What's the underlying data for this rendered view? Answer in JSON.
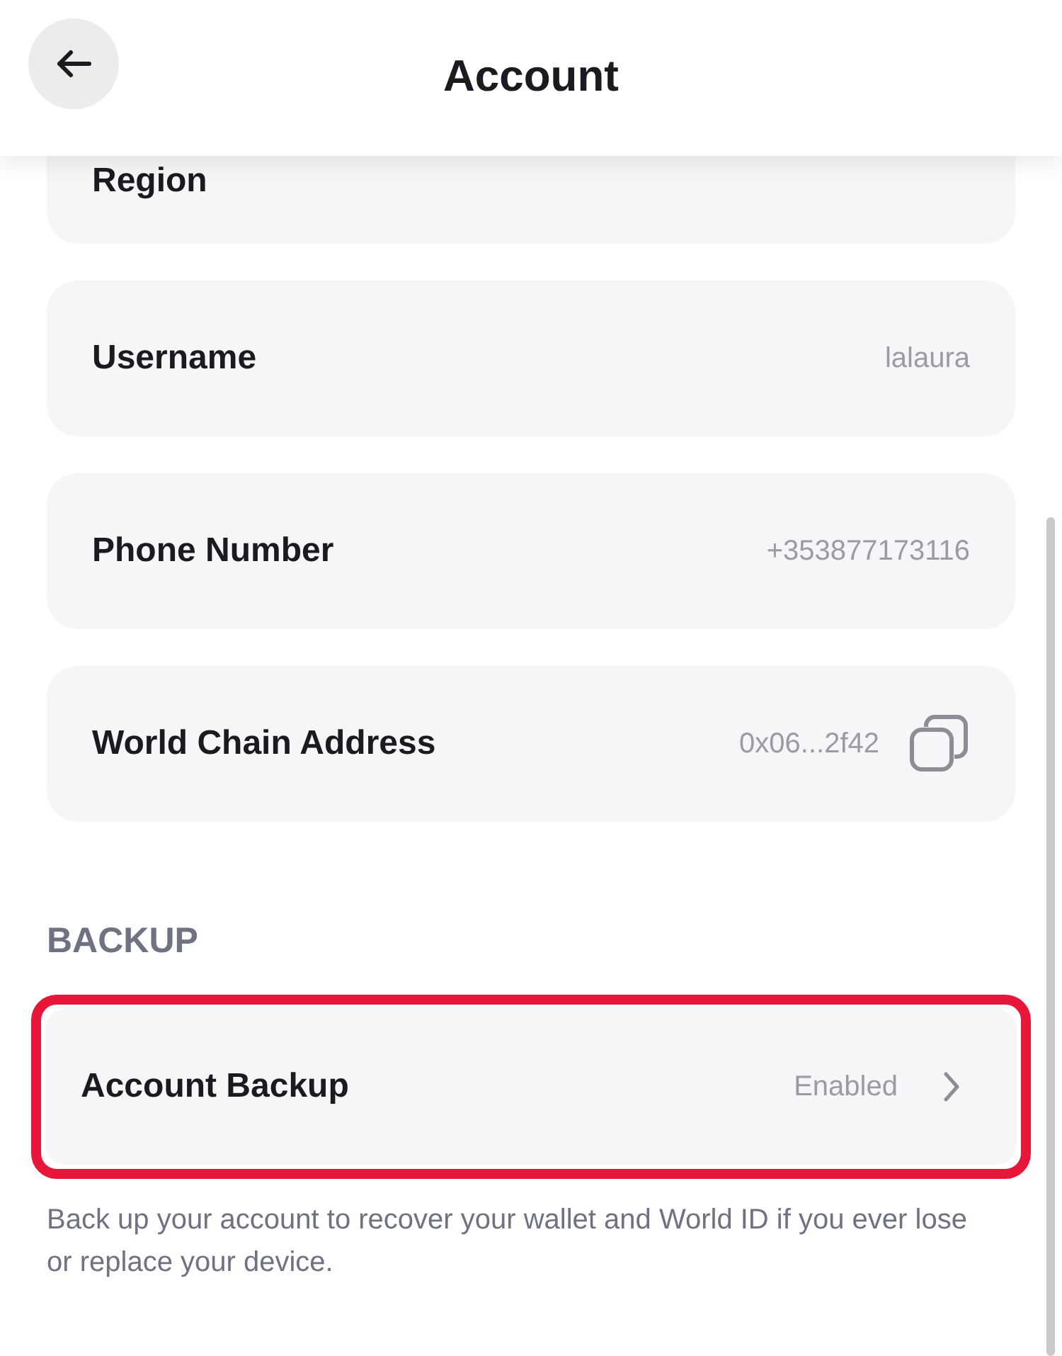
{
  "header": {
    "title": "Account"
  },
  "rows": [
    {
      "label": "Region",
      "copy": false
    },
    {
      "label": "Username",
      "value": "lalaura",
      "copy": false
    },
    {
      "label": "Phone Number",
      "value": "+353877173116",
      "copy": false
    },
    {
      "label": "World Chain Address",
      "value": "0x06...2f42",
      "copy": true
    }
  ],
  "backup": {
    "heading": "BACKUP",
    "item": {
      "label": "Account Backup",
      "value": "Enabled",
      "highlighted": true
    },
    "note": "Back up your account to recover your wallet and World ID if you ever lose or replace your device."
  }
}
